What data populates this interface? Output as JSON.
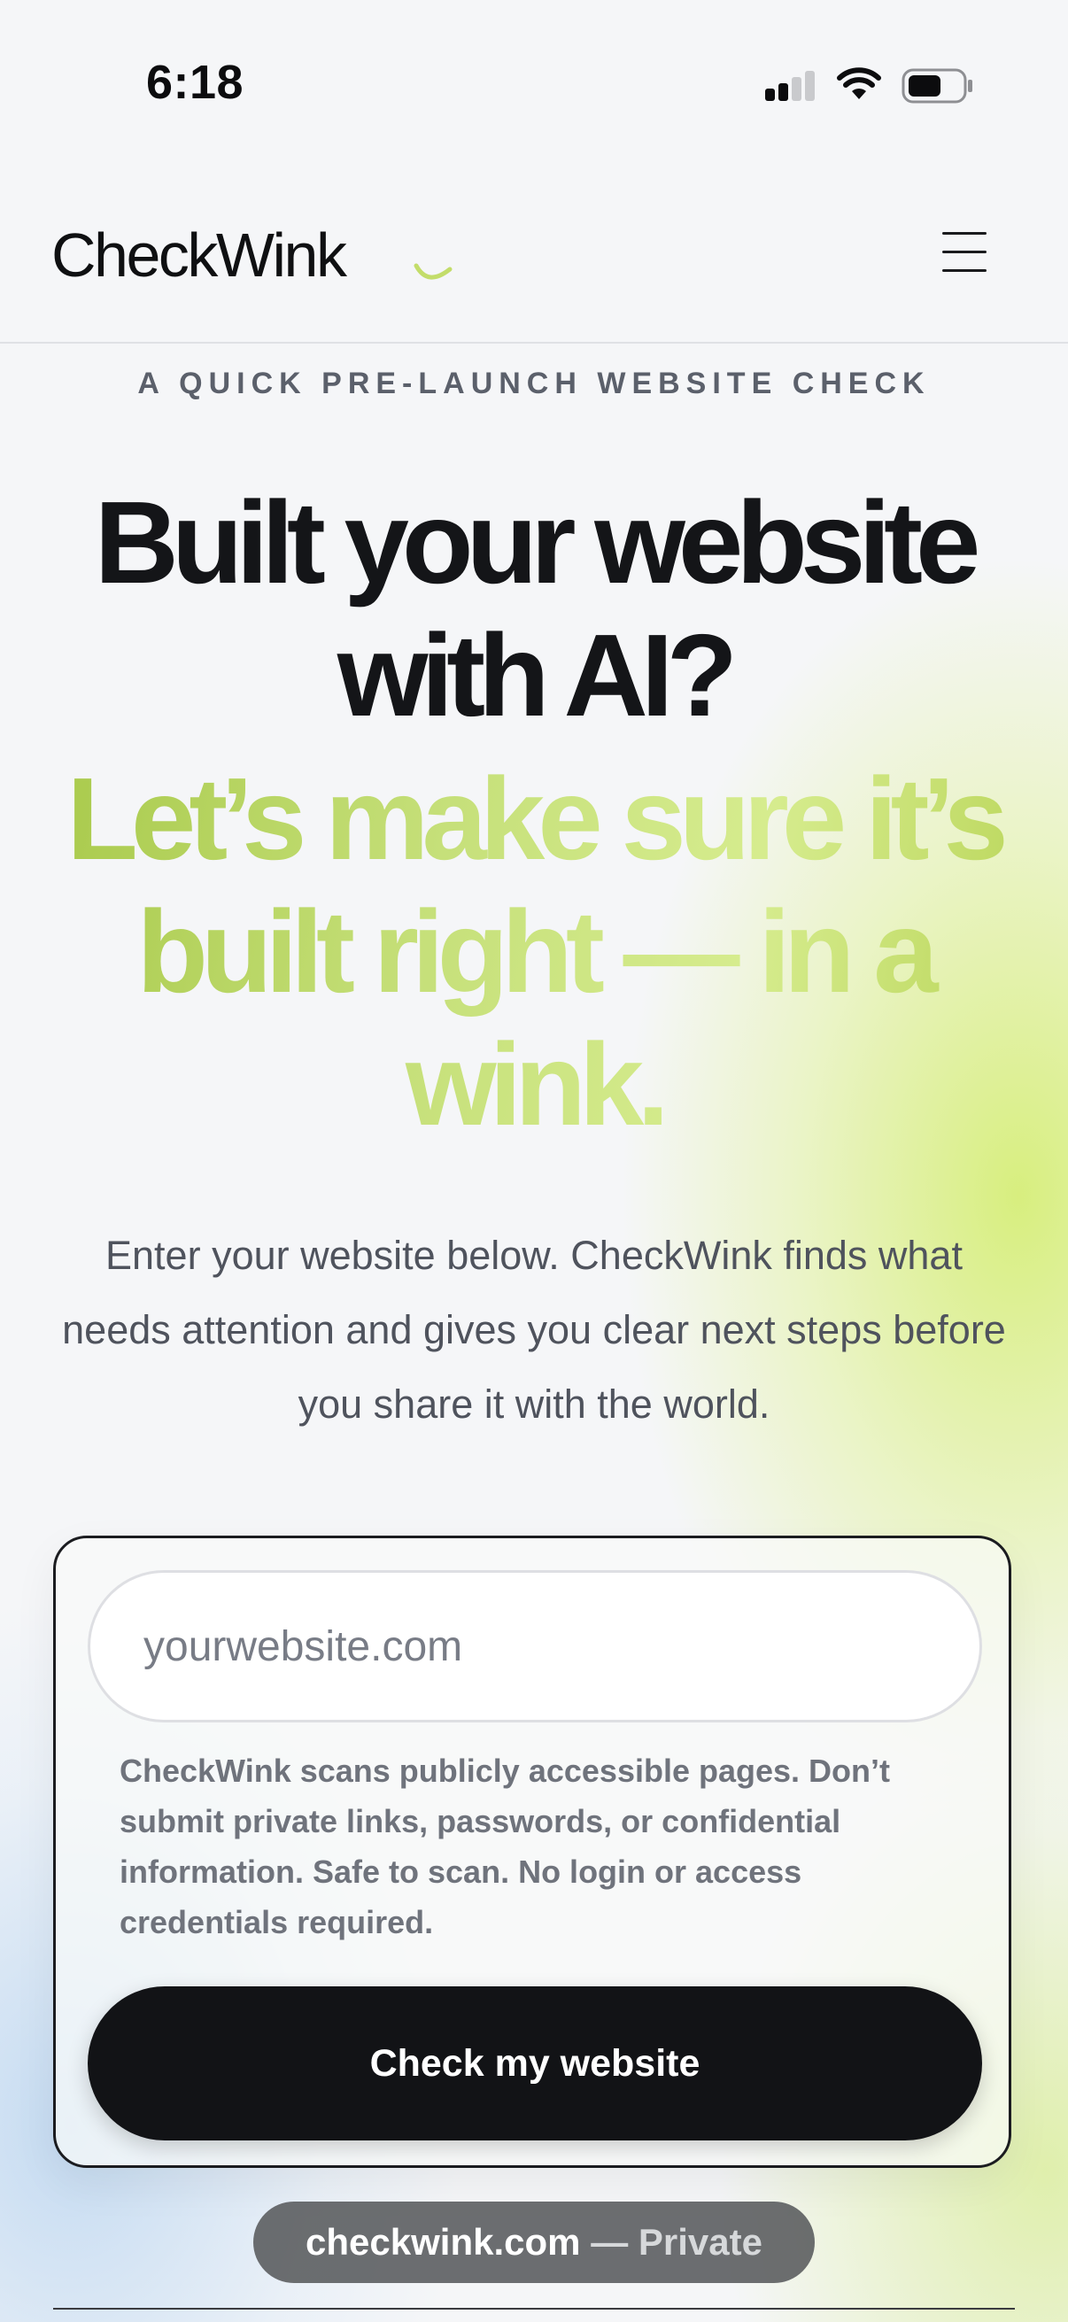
{
  "status_bar": {
    "time": "6:18",
    "icons": [
      "cellular-signal-icon",
      "wifi-icon",
      "battery-icon"
    ]
  },
  "header": {
    "logo_text": "CheckWink",
    "menu_icon": "hamburger-menu-icon"
  },
  "hero": {
    "eyebrow": "A QUICK PRE-LAUNCH WEBSITE CHECK",
    "title": "Built your website with AI?",
    "subtitle": "Let’s make sure it’s built right — in a wink.",
    "description": "Enter your website below. CheckWink finds what needs attention and gives you clear next steps before you share it with the world."
  },
  "form": {
    "url_placeholder": "yourwebsite.com",
    "url_value": "",
    "privacy_note": "CheckWink scans publicly accessible pages. Don’t submit private links, passwords, or confidential information. Safe to scan. No login or access credentials required.",
    "submit_label": "Check my website"
  },
  "browser": {
    "domain": "checkwink.com",
    "mode": "— Private"
  },
  "colors": {
    "accent_green": "#c6e07a",
    "button_dark": "#121316",
    "text_dark": "#141518",
    "text_muted": "#4f535d"
  }
}
